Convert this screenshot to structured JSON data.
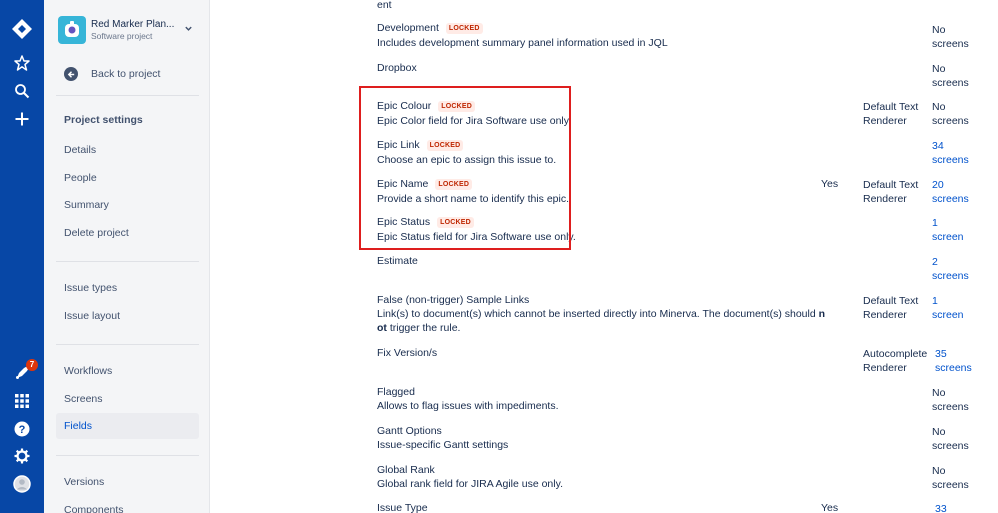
{
  "project": {
    "name": "Red Marker Plan...",
    "type": "Software project"
  },
  "sidebar": {
    "back_label": "Back to project",
    "heading": "Project settings",
    "group1": [
      "Details",
      "People",
      "Summary",
      "Delete project"
    ],
    "group2": [
      "Issue types",
      "Issue layout"
    ],
    "group3": [
      "Workflows",
      "Screens",
      "Fields"
    ],
    "group4": [
      "Versions",
      "Components"
    ]
  },
  "global_nav": {
    "notification_count": "7"
  },
  "locked_label": "LOCKED",
  "fields": [
    {
      "name": "ent",
      "description": "",
      "required": "",
      "renderer": "",
      "screens": ""
    },
    {
      "name": "Development",
      "locked": true,
      "description": "Includes development summary panel information used in JQL",
      "required": "",
      "renderer": "",
      "screens": "No screens"
    },
    {
      "name": "Dropbox",
      "description": "",
      "required": "",
      "renderer": "",
      "screens": "No screens"
    },
    {
      "name": "Epic Colour",
      "locked": true,
      "description": "Epic Color field for Jira Software use only.",
      "required": "",
      "renderer": "Default Text Renderer",
      "screens": "No screens"
    },
    {
      "name": "Epic Link",
      "locked": true,
      "description": "Choose an epic to assign this issue to.",
      "required": "",
      "renderer": "",
      "screens": "34 screens"
    },
    {
      "name": "Epic Name",
      "locked": true,
      "description": "Provide a short name to identify this epic.",
      "required": "Yes",
      "renderer": "Default Text Renderer",
      "screens": "20 screens"
    },
    {
      "name": "Epic Status",
      "locked": true,
      "description": "Epic Status field for Jira Software use only.",
      "required": "",
      "renderer": "",
      "screens": "1 screen"
    },
    {
      "name": "Estimate",
      "description": "",
      "required": "",
      "renderer": "",
      "screens": "2 screens"
    },
    {
      "name": "False (non-trigger) Sample Links",
      "description": "Link(s) to document(s) which cannot be inserted directly into Minerva. The document(s) should n",
      "description_bold": "n",
      "description_line2_bold": "ot",
      "description_line2": " trigger the rule.",
      "required": "",
      "renderer": "Default Text Renderer",
      "screens": "1 screen"
    },
    {
      "name": "Fix Version/s",
      "description": "",
      "required": "",
      "renderer": "Autocomplete Renderer",
      "screens": "35 screens"
    },
    {
      "name": "Flagged",
      "description": "Allows to flag issues with impediments.",
      "required": "",
      "renderer": "",
      "screens": "No screens"
    },
    {
      "name": "Gantt Options",
      "description": "Issue-specific Gantt settings",
      "required": "",
      "renderer": "",
      "screens": "No screens"
    },
    {
      "name": "Global Rank",
      "description": "Global rank field for JIRA Agile use only.",
      "required": "",
      "renderer": "",
      "screens": "No screens"
    },
    {
      "name": "Issue Type",
      "description": "",
      "required": "Yes",
      "renderer": "",
      "screens": "33"
    }
  ],
  "colors": {
    "global_nav": "#0747a6",
    "link": "#0052cc",
    "highlight": "#de1e1e",
    "locked_bg": "#ffebe6",
    "locked_text": "#bf2600"
  }
}
